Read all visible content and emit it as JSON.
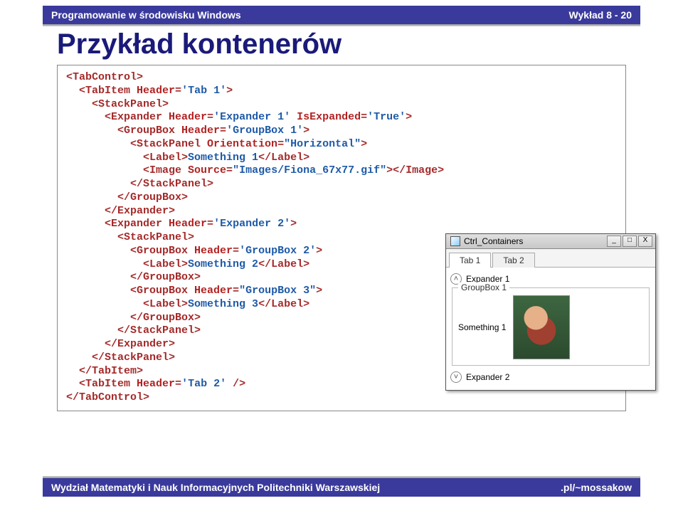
{
  "header": {
    "left": "Programowanie w środowisku Windows",
    "right": "Wykład 8 - 20"
  },
  "title": "Przykład kontenerów",
  "code": {
    "l01": "<TabControl>",
    "l02": "  <TabItem Header='Tab 1'>",
    "l03": "    <StackPanel>",
    "l04": "      <Expander Header='Expander 1' IsExpanded='True'>",
    "l05": "        <GroupBox Header='GroupBox 1'>",
    "l06": "          <StackPanel Orientation=\"Horizontal\">",
    "l07": "            <Label>Something 1</Label>",
    "l08": "            <Image Source=\"Images/Fiona_67x77.gif\"></Image>",
    "l09": "          </StackPanel>",
    "l10": "        </GroupBox>",
    "l11": "      </Expander>",
    "l12": "      <Expander Header='Expander 2'>",
    "l13": "        <StackPanel>",
    "l14": "          <GroupBox Header='GroupBox 2'>",
    "l15": "            <Label>Something 2</Label>",
    "l16": "          </GroupBox>",
    "l17": "          <GroupBox Header=\"GroupBox 3\">",
    "l18": "            <Label>Something 3</Label>",
    "l19": "          </GroupBox>",
    "l20": "        </StackPanel>",
    "l21": "      </Expander>",
    "l22": "    </StackPanel>",
    "l23": "  </TabItem>",
    "l24": "  <TabItem Header='Tab 2' />",
    "l25": "</TabControl>"
  },
  "window": {
    "title": "Ctrl_Containers",
    "buttons": {
      "min": "_",
      "max": "□",
      "close": "X"
    },
    "tabs": [
      "Tab 1",
      "Tab 2"
    ],
    "expander1": {
      "icon": "˄",
      "label": "Expander 1"
    },
    "groupbox1": {
      "legend": "GroupBox 1",
      "label": "Something 1"
    },
    "expander2": {
      "icon": "˅",
      "label": "Expander 2"
    }
  },
  "footer": {
    "left": "Wydział Matematyki i Nauk Informacyjnych Politechniki Warszawskiej",
    "right": ".pl/~mossakow"
  }
}
